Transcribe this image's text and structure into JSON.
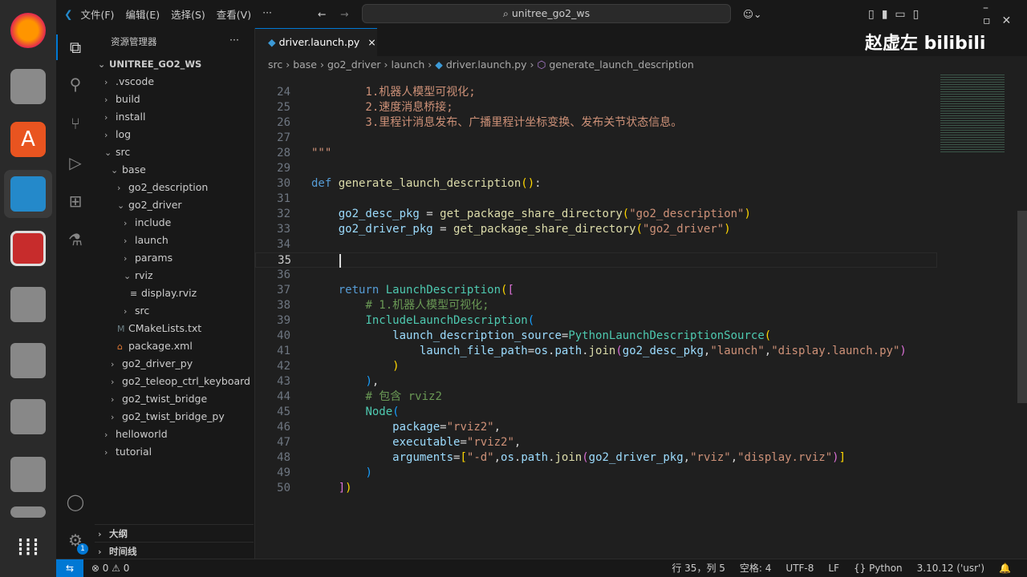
{
  "menu": [
    "文件(F)",
    "编辑(E)",
    "选择(S)",
    "查看(V)",
    "···"
  ],
  "search": "unitree_go2_ws",
  "watermark": "赵虚左 bilibili",
  "sidebar": {
    "title": "资源管理器",
    "more": "···",
    "root": "UNITREE_GO2_WS",
    "items": [
      {
        "label": ".vscode",
        "depth": 1,
        "type": "closed"
      },
      {
        "label": "build",
        "depth": 1,
        "type": "closed"
      },
      {
        "label": "install",
        "depth": 1,
        "type": "closed"
      },
      {
        "label": "log",
        "depth": 1,
        "type": "closed"
      },
      {
        "label": "src",
        "depth": 1,
        "type": "open"
      },
      {
        "label": "base",
        "depth": 2,
        "type": "open"
      },
      {
        "label": "go2_description",
        "depth": 3,
        "type": "closed"
      },
      {
        "label": "go2_driver",
        "depth": 3,
        "type": "open"
      },
      {
        "label": "include",
        "depth": 4,
        "type": "closed"
      },
      {
        "label": "launch",
        "depth": 4,
        "type": "closed"
      },
      {
        "label": "params",
        "depth": 4,
        "type": "closed"
      },
      {
        "label": "rviz",
        "depth": 4,
        "type": "open"
      },
      {
        "label": "display.rviz",
        "depth": 5,
        "type": "file",
        "icon": "≡",
        "color": "#ccc"
      },
      {
        "label": "src",
        "depth": 4,
        "type": "closed"
      },
      {
        "label": "CMakeLists.txt",
        "depth": 3,
        "type": "file",
        "icon": "M",
        "color": "#6d8086"
      },
      {
        "label": "package.xml",
        "depth": 3,
        "type": "file",
        "icon": "⌂",
        "color": "#e37933"
      },
      {
        "label": "go2_driver_py",
        "depth": 2,
        "type": "closed"
      },
      {
        "label": "go2_teleop_ctrl_keyboard",
        "depth": 2,
        "type": "closed"
      },
      {
        "label": "go2_twist_bridge",
        "depth": 2,
        "type": "closed"
      },
      {
        "label": "go2_twist_bridge_py",
        "depth": 2,
        "type": "closed"
      },
      {
        "label": "helloworld",
        "depth": 1,
        "type": "closed"
      },
      {
        "label": "tutorial",
        "depth": 1,
        "type": "closed"
      }
    ],
    "outline": "大纲",
    "timeline": "时间线"
  },
  "tab": {
    "label": "driver.launch.py",
    "close": "×"
  },
  "breadcrumb": [
    "src",
    "base",
    "go2_driver",
    "launch",
    "driver.launch.py",
    "generate_launch_description"
  ],
  "code": [
    {
      "n": 24,
      "t": [
        [
          "str",
          "        1.机器人模型可视化;"
        ]
      ]
    },
    {
      "n": 25,
      "t": [
        [
          "str",
          "        2.速度消息桥接;"
        ]
      ]
    },
    {
      "n": 26,
      "t": [
        [
          "str",
          "        3.里程计消息发布、广播里程计坐标变换、发布关节状态信息。"
        ]
      ]
    },
    {
      "n": 27,
      "t": []
    },
    {
      "n": 28,
      "t": [
        [
          "str",
          "\"\"\""
        ]
      ]
    },
    {
      "n": 29,
      "t": []
    },
    {
      "n": 30,
      "t": [
        [
          "kw",
          "def "
        ],
        [
          "fn",
          "generate_launch_description"
        ],
        [
          "b1",
          "()"
        ],
        [
          "p",
          ":"
        ]
      ]
    },
    {
      "n": 31,
      "t": []
    },
    {
      "n": 32,
      "t": [
        [
          "p",
          "    "
        ],
        [
          "var",
          "go2_desc_pkg"
        ],
        [
          "p",
          " = "
        ],
        [
          "fn",
          "get_package_share_directory"
        ],
        [
          "b1",
          "("
        ],
        [
          "str",
          "\"go2_description\""
        ],
        [
          "b1",
          ")"
        ]
      ]
    },
    {
      "n": 33,
      "t": [
        [
          "p",
          "    "
        ],
        [
          "var",
          "go2_driver_pkg"
        ],
        [
          "p",
          " = "
        ],
        [
          "fn",
          "get_package_share_directory"
        ],
        [
          "b1",
          "("
        ],
        [
          "str",
          "\"go2_driver\""
        ],
        [
          "b1",
          ")"
        ]
      ]
    },
    {
      "n": 34,
      "t": []
    },
    {
      "n": 35,
      "t": [
        [
          "p",
          "    "
        ]
      ]
    },
    {
      "n": 36,
      "t": []
    },
    {
      "n": 37,
      "t": [
        [
          "p",
          "    "
        ],
        [
          "kw",
          "return "
        ],
        [
          "cls",
          "LaunchDescription"
        ],
        [
          "b1",
          "("
        ],
        [
          "b2",
          "["
        ]
      ]
    },
    {
      "n": 38,
      "t": [
        [
          "p",
          "        "
        ],
        [
          "cm",
          "# 1.机器人模型可视化;"
        ]
      ]
    },
    {
      "n": 39,
      "t": [
        [
          "p",
          "        "
        ],
        [
          "cls",
          "IncludeLaunchDescription"
        ],
        [
          "b3",
          "("
        ]
      ]
    },
    {
      "n": 40,
      "t": [
        [
          "p",
          "            "
        ],
        [
          "var",
          "launch_description_source"
        ],
        [
          "p",
          "="
        ],
        [
          "cls",
          "PythonLaunchDescriptionSource"
        ],
        [
          "b1",
          "("
        ]
      ]
    },
    {
      "n": 41,
      "t": [
        [
          "p",
          "                "
        ],
        [
          "var",
          "launch_file_path"
        ],
        [
          "p",
          "="
        ],
        [
          "var",
          "os"
        ],
        [
          "p",
          "."
        ],
        [
          "var",
          "path"
        ],
        [
          "p",
          "."
        ],
        [
          "fn",
          "join"
        ],
        [
          "b2",
          "("
        ],
        [
          "var",
          "go2_desc_pkg"
        ],
        [
          "p",
          ","
        ],
        [
          "str",
          "\"launch\""
        ],
        [
          "p",
          ","
        ],
        [
          "str",
          "\"display.launch.py\""
        ],
        [
          "b2",
          ")"
        ]
      ]
    },
    {
      "n": 42,
      "t": [
        [
          "p",
          "            "
        ],
        [
          "b1",
          ")"
        ]
      ]
    },
    {
      "n": 43,
      "t": [
        [
          "p",
          "        "
        ],
        [
          "b3",
          ")"
        ],
        [
          "p",
          ","
        ]
      ]
    },
    {
      "n": 44,
      "t": [
        [
          "p",
          "        "
        ],
        [
          "cm",
          "# 包含 rviz2"
        ]
      ]
    },
    {
      "n": 45,
      "t": [
        [
          "p",
          "        "
        ],
        [
          "cls",
          "Node"
        ],
        [
          "b3",
          "("
        ]
      ]
    },
    {
      "n": 46,
      "t": [
        [
          "p",
          "            "
        ],
        [
          "var",
          "package"
        ],
        [
          "p",
          "="
        ],
        [
          "str",
          "\"rviz2\""
        ],
        [
          "p",
          ","
        ]
      ]
    },
    {
      "n": 47,
      "t": [
        [
          "p",
          "            "
        ],
        [
          "var",
          "executable"
        ],
        [
          "p",
          "="
        ],
        [
          "str",
          "\"rviz2\""
        ],
        [
          "p",
          ","
        ]
      ]
    },
    {
      "n": 48,
      "t": [
        [
          "p",
          "            "
        ],
        [
          "var",
          "arguments"
        ],
        [
          "p",
          "="
        ],
        [
          "b1",
          "["
        ],
        [
          "str",
          "\"-d\""
        ],
        [
          "p",
          ","
        ],
        [
          "var",
          "os"
        ],
        [
          "p",
          "."
        ],
        [
          "var",
          "path"
        ],
        [
          "p",
          "."
        ],
        [
          "fn",
          "join"
        ],
        [
          "b2",
          "("
        ],
        [
          "var",
          "go2_driver_pkg"
        ],
        [
          "p",
          ","
        ],
        [
          "str",
          "\"rviz\""
        ],
        [
          "p",
          ","
        ],
        [
          "str",
          "\"display.rviz\""
        ],
        [
          "b2",
          ")"
        ],
        [
          "b1",
          "]"
        ]
      ]
    },
    {
      "n": 49,
      "t": [
        [
          "p",
          "        "
        ],
        [
          "b3",
          ")"
        ]
      ]
    },
    {
      "n": 50,
      "t": [
        [
          "p",
          "    "
        ],
        [
          "b2",
          "]"
        ],
        [
          "b1",
          ")"
        ]
      ]
    }
  ],
  "current_line": 35,
  "status": {
    "errors": "0",
    "warnings": "0",
    "position": "行 35，列 5",
    "spaces": "空格: 4",
    "encoding": "UTF-8",
    "eol": "LF",
    "language": "{} Python",
    "interpreter": "3.10.12 ('usr')"
  },
  "notifications": "1"
}
